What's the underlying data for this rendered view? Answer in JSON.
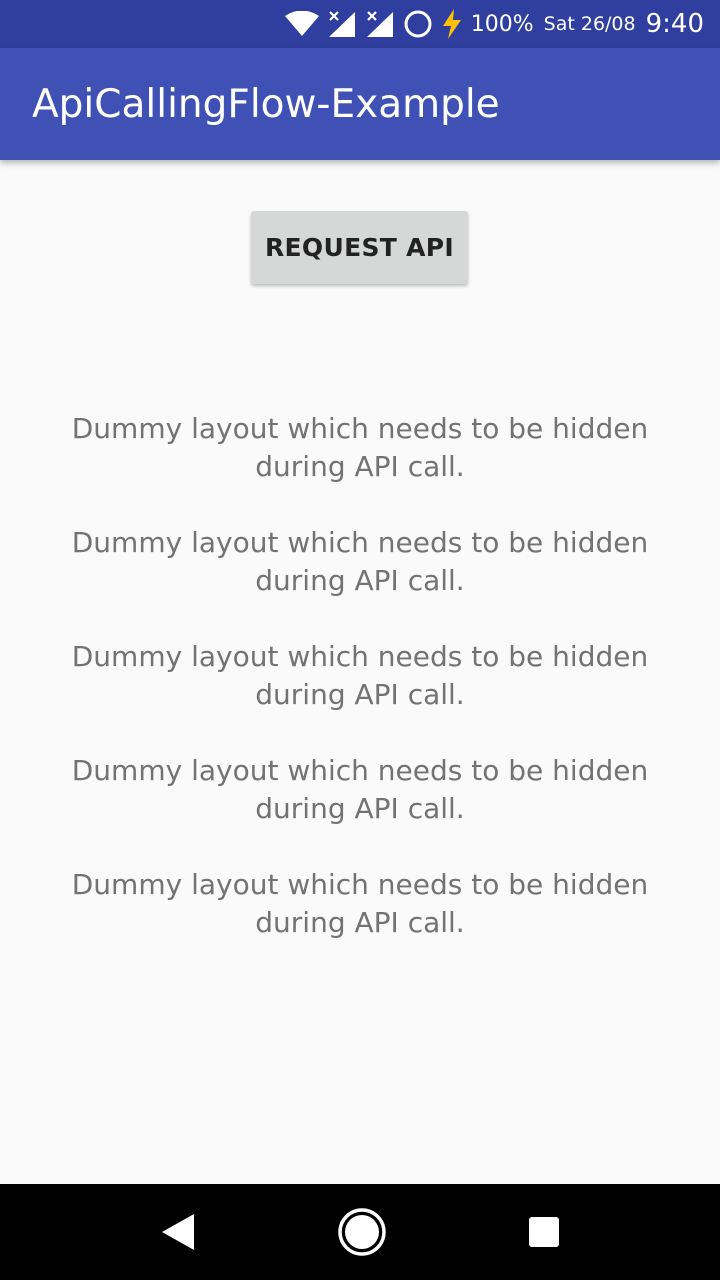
{
  "status_bar": {
    "battery_percent": "100%",
    "date": "Sat 26/08",
    "time": "9:40",
    "icons": [
      "wifi-icon",
      "signal-icon",
      "signal-icon",
      "sync-circle-icon",
      "charging-icon"
    ]
  },
  "app_bar": {
    "title": "ApiCallingFlow-Example"
  },
  "main": {
    "request_button_label": "REQUEST API",
    "dummy_texts": [
      "Dummy layout which needs to be hidden during API call.",
      "Dummy layout which needs to be hidden during API call.",
      "Dummy layout which needs to be hidden during API call.",
      "Dummy layout which needs to be hidden during API call.",
      "Dummy layout which needs to be hidden during API call."
    ]
  },
  "nav_bar": {
    "icons": [
      "back-icon",
      "home-icon",
      "recents-icon"
    ]
  },
  "colors": {
    "status_bar": "#303f9f",
    "app_bar": "#3f51b5",
    "background": "#fafafa",
    "button": "#d6d7d7",
    "text_secondary": "#737373"
  }
}
